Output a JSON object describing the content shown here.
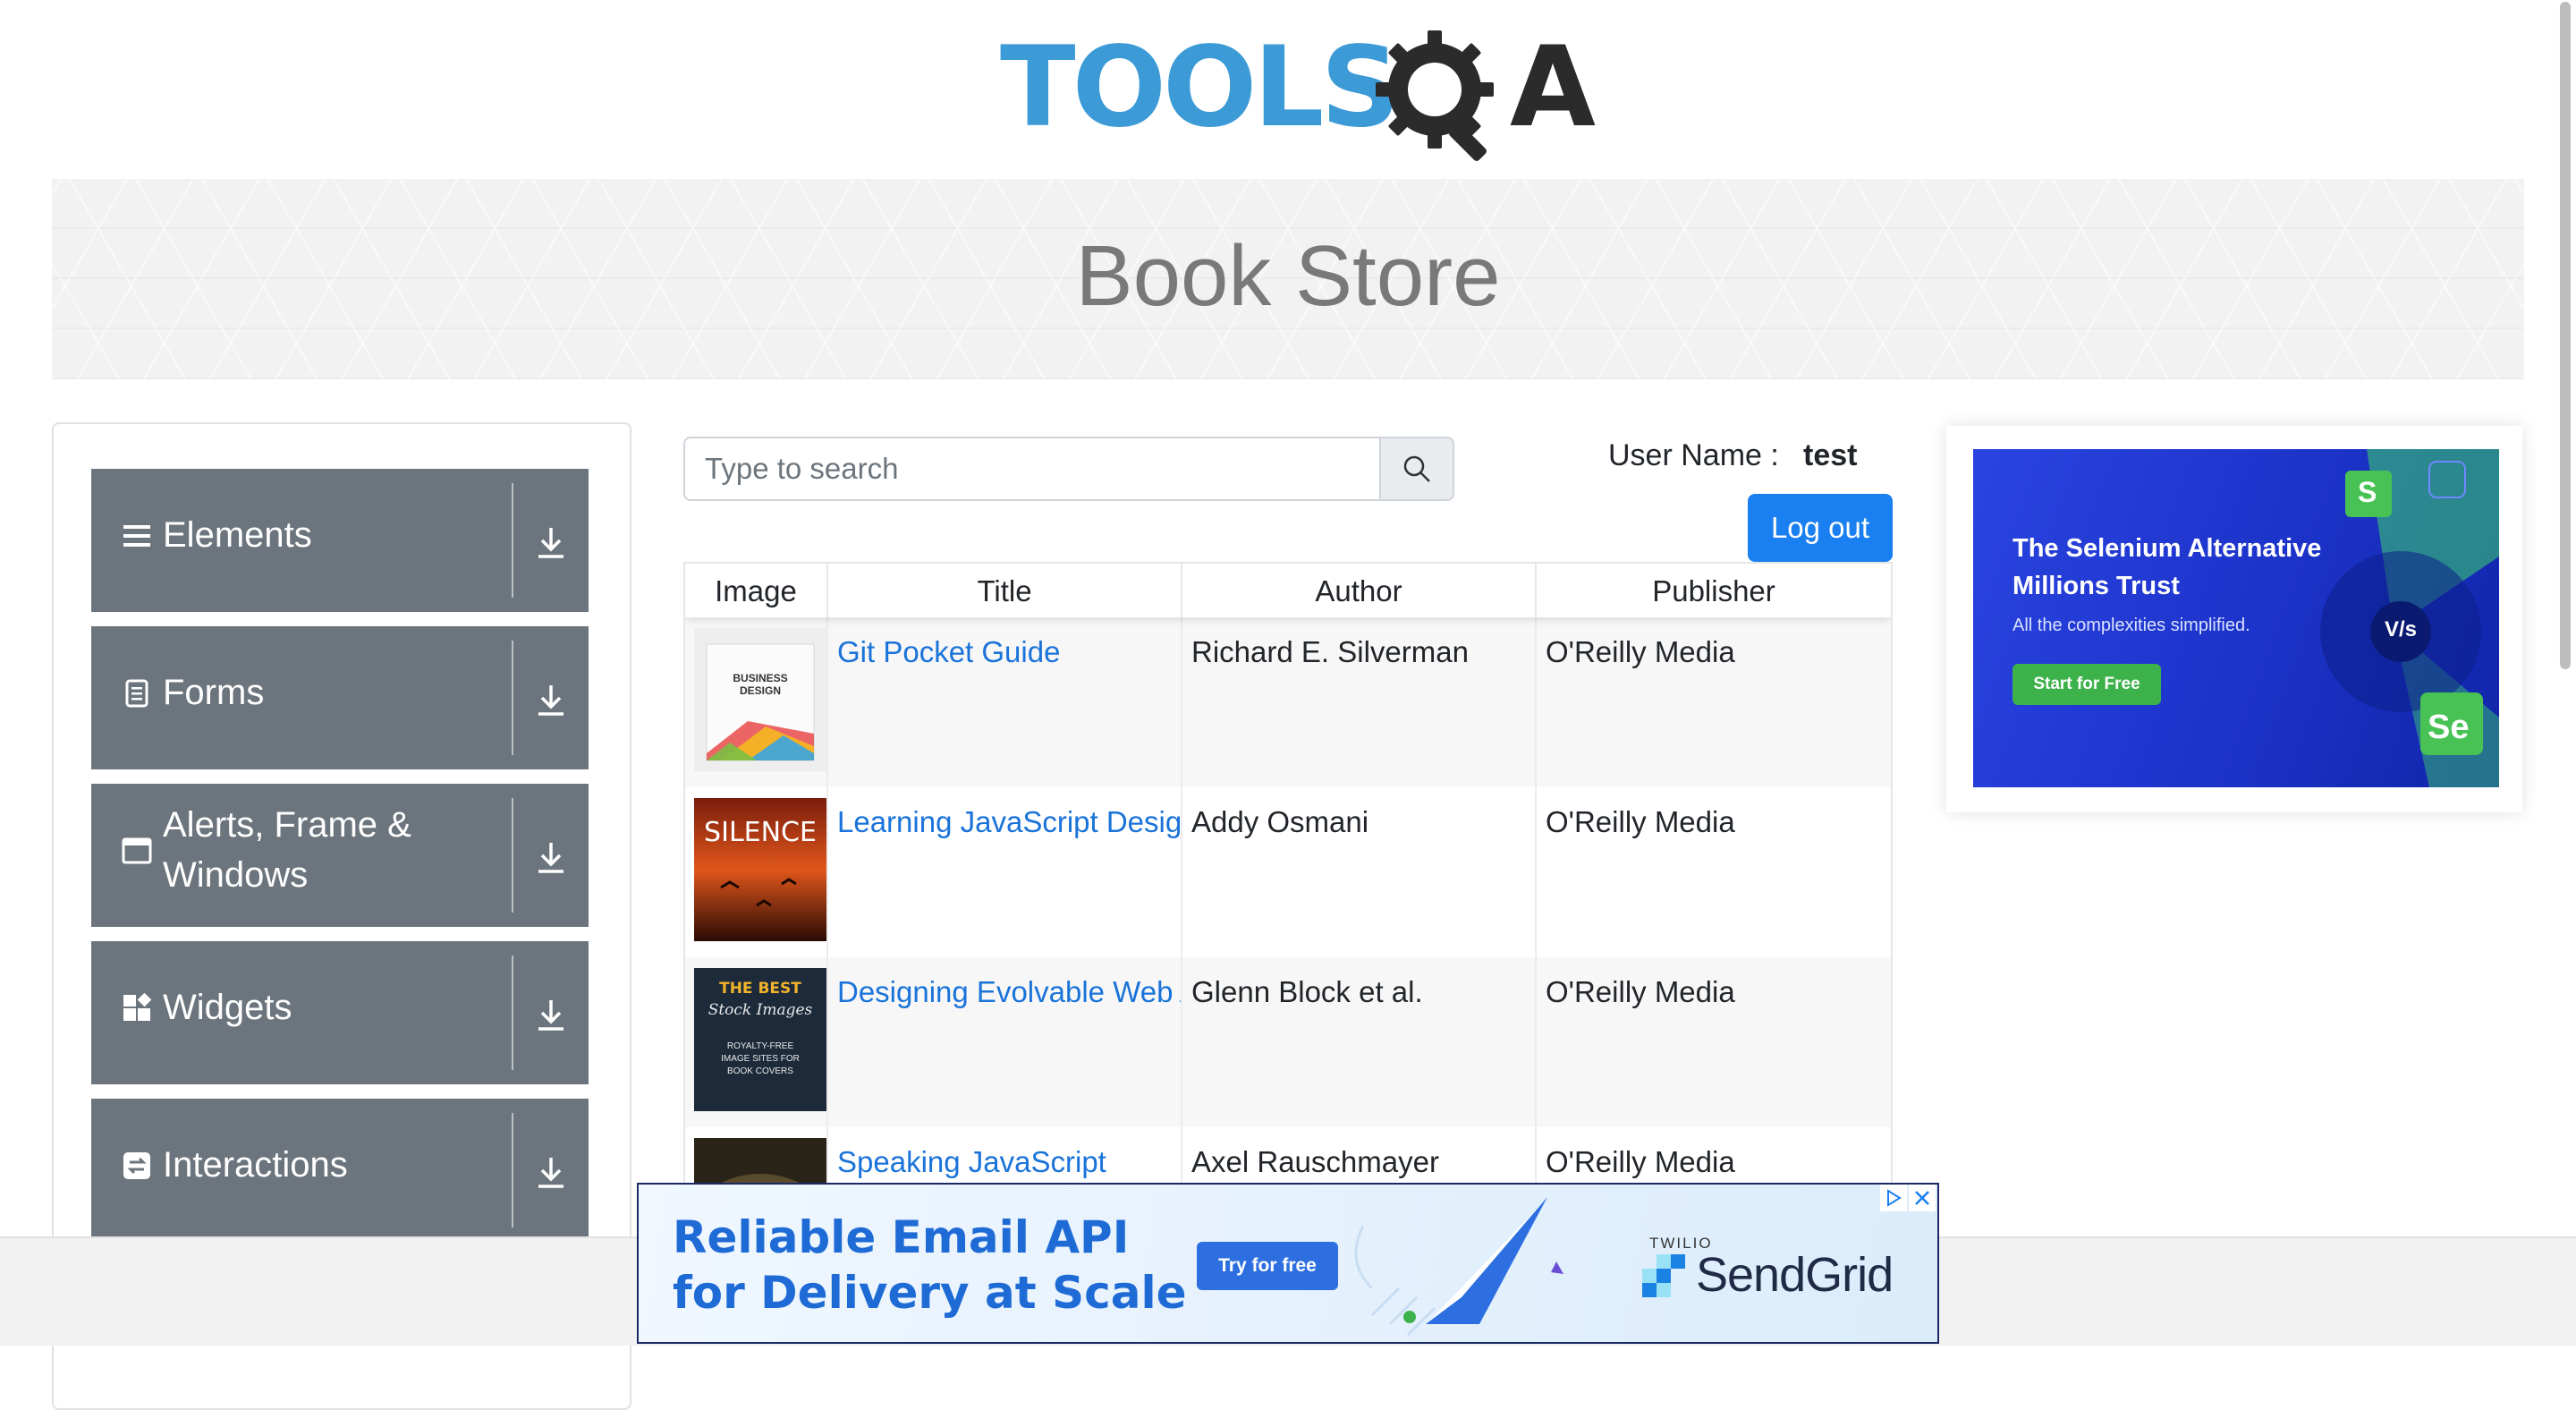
{
  "logo": {
    "text_left": "TOOLS",
    "text_right": "A"
  },
  "banner": {
    "title": "Book Store"
  },
  "sidebar": {
    "groups": [
      {
        "label": "Elements",
        "icon": "menu-icon"
      },
      {
        "label": "Forms",
        "icon": "document-icon"
      },
      {
        "label": "Alerts, Frame & Windows",
        "icon": "window-icon"
      },
      {
        "label": "Widgets",
        "icon": "widgets-icon"
      },
      {
        "label": "Interactions",
        "icon": "interactions-icon"
      }
    ]
  },
  "search": {
    "placeholder": "Type to search",
    "icon": "search-icon"
  },
  "user": {
    "label": "User Name :",
    "value": "test",
    "logout_label": "Log out"
  },
  "table": {
    "headers": [
      "Image",
      "Title",
      "Author",
      "Publisher"
    ],
    "rows": [
      {
        "title": "Git Pocket Guide",
        "author": "Richard E. Silverman",
        "publisher": "O'Reilly Media"
      },
      {
        "title": "Learning JavaScript Design Patterns",
        "author": "Addy Osmani",
        "publisher": "O'Reilly Media"
      },
      {
        "title": "Designing Evolvable Web APIs with ASP.NET",
        "author": "Glenn Block et al.",
        "publisher": "O'Reilly Media"
      },
      {
        "title": "Speaking JavaScript",
        "author": "Axel Rauschmayer",
        "publisher": "O'Reilly Media"
      }
    ]
  },
  "covers": [
    {
      "lines": [
        "BUSINESS",
        "DESIGN"
      ]
    },
    {
      "lines": [
        "SILENCE"
      ]
    },
    {
      "lines": [
        "THE BEST",
        "Stock Images",
        "ROYALTY-FREE",
        "IMAGE SITES FOR",
        "BOOK COVERS"
      ]
    }
  ],
  "ad_side": {
    "headline": "The Selenium Alternative Millions Trust",
    "sub": "All the complexities simplified.",
    "cta": "Start for Free",
    "badge_s": "S",
    "badge_se": "Se",
    "badge_vs": "V/s"
  },
  "ad_bottom": {
    "headline_1": "Reliable Email API",
    "headline_2": "for Delivery at Scale",
    "cta": "Try for free",
    "brand_small": "TWILIO",
    "brand": "SendGrid"
  },
  "colors": {
    "accent": "#1a7ff1",
    "sidebar": "#6c757d",
    "link": "#1a73d9",
    "logo_blue": "#3c9ad6"
  }
}
